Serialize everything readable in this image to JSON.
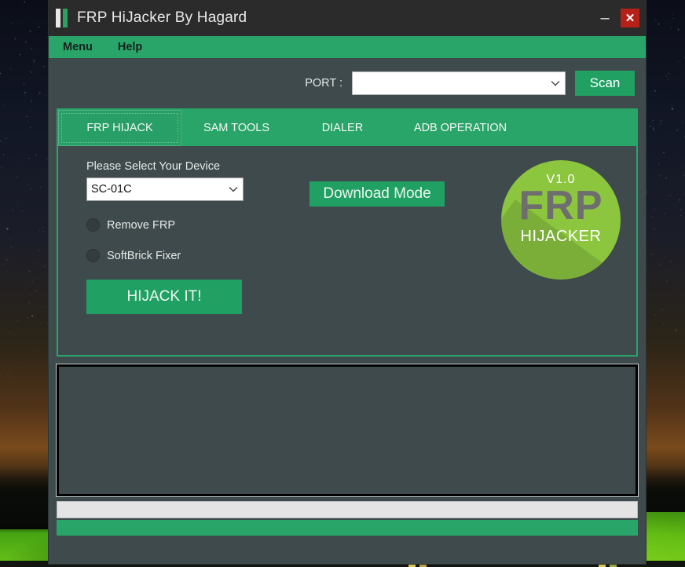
{
  "window": {
    "title": "FRP HiJacker By Hagard",
    "logo_mark": "two-bar-logo",
    "minimize_label": "–",
    "close_label": "✕"
  },
  "menubar": {
    "items": [
      {
        "label": "Menu"
      },
      {
        "label": "Help"
      }
    ]
  },
  "port_row": {
    "label": "PORT :",
    "selected_value": "",
    "placeholder": "",
    "caret": "⌄",
    "scan_label": "Scan"
  },
  "tabs": [
    {
      "id": "frp",
      "label": "FRP HIJACK",
      "active": true
    },
    {
      "id": "sam",
      "label": "SAM TOOLS",
      "active": false
    },
    {
      "id": "dialer",
      "label": "DIALER",
      "active": false
    },
    {
      "id": "adb",
      "label": "ADB OPERATION",
      "active": false
    }
  ],
  "frp_panel": {
    "device_label": "Please Select Your Device",
    "device_selected": "SC-01C",
    "device_caret": "⌄",
    "download_mode_label": "Download Mode",
    "options": [
      {
        "label": "Remove FRP",
        "selected": false
      },
      {
        "label": "SoftBrick Fixer",
        "selected": false
      }
    ],
    "hijack_label": "HIJACK IT!"
  },
  "logo": {
    "version": "V1.0",
    "name": "FRP",
    "subtitle": "HIJACKER",
    "circle_color": "#8cc63f",
    "word_color": "#6e6e6e"
  },
  "console": {
    "text": ""
  },
  "progress": {
    "percent": 0
  },
  "status_bar": {
    "text": ""
  },
  "theme": {
    "accent_green": "#2aa56a",
    "button_green": "#20a163",
    "window_bg": "#3e4a4c",
    "titlebar_bg": "#2b2b2b",
    "close_red": "#b52119"
  }
}
